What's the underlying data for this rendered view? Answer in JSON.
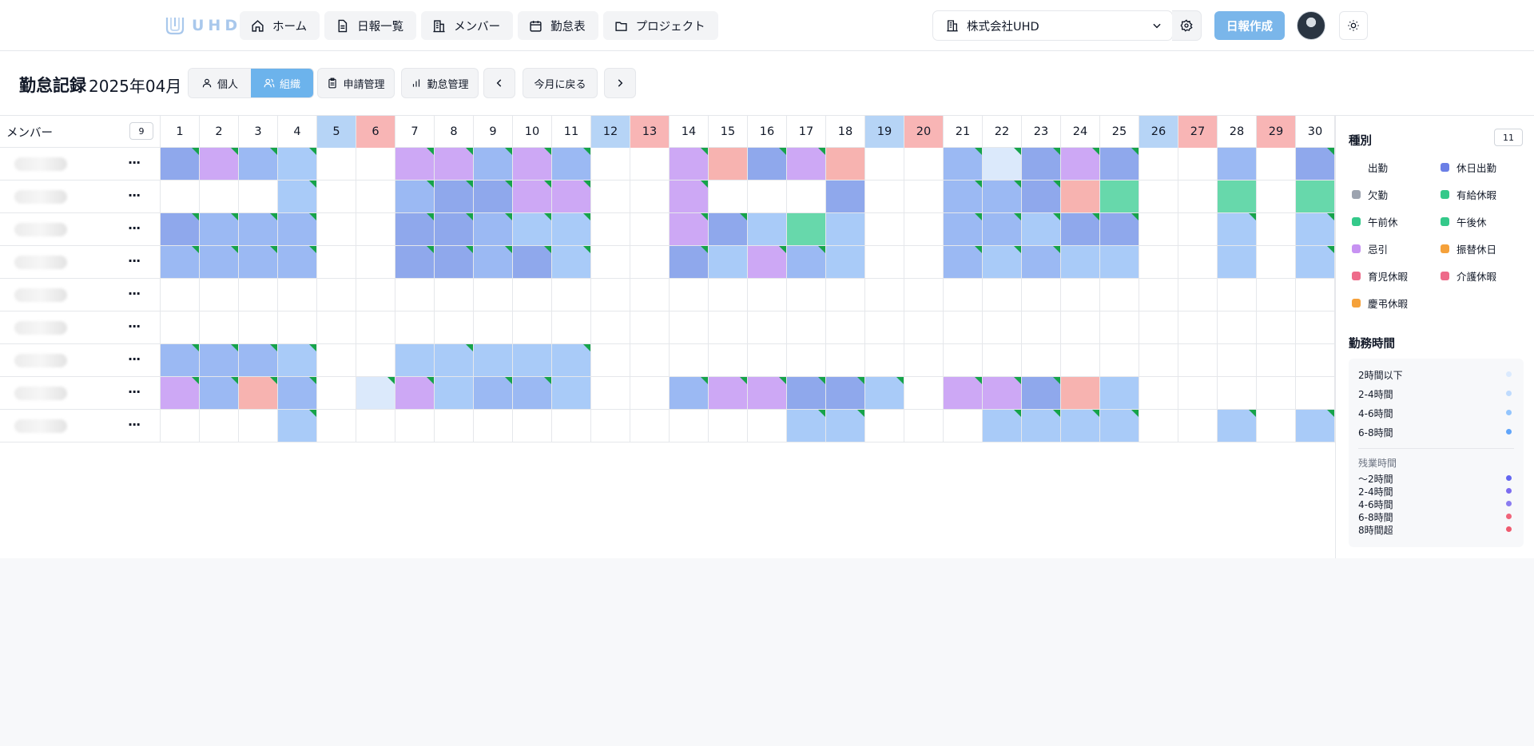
{
  "nav": {
    "logo_text": "UHD",
    "items": [
      {
        "label": "ホーム",
        "icon": "home-icon"
      },
      {
        "label": "日報一覧",
        "icon": "document-icon"
      },
      {
        "label": "メンバー",
        "icon": "building-icon"
      },
      {
        "label": "勤怠表",
        "icon": "calendar-icon"
      },
      {
        "label": "プロジェクト",
        "icon": "folder-icon"
      }
    ],
    "company": "株式会社UHD",
    "create_label": "日報作成"
  },
  "toolbar": {
    "title": "勤怠記録",
    "month": "2025年04月",
    "view_individual": "個人",
    "view_org": "組織",
    "requests": "申請管理",
    "attendance": "勤怠管理",
    "today": "今月に戻る"
  },
  "grid": {
    "member_header": "メンバー",
    "member_count": "9",
    "days": [
      "1",
      "2",
      "3",
      "4",
      "5",
      "6",
      "7",
      "8",
      "9",
      "10",
      "11",
      "12",
      "13",
      "14",
      "15",
      "16",
      "17",
      "18",
      "19",
      "20",
      "21",
      "22",
      "23",
      "24",
      "25",
      "26",
      "27",
      "28",
      "29",
      "30"
    ],
    "saturdays": [
      5,
      12,
      19,
      26
    ],
    "sundays": [
      6,
      13,
      20,
      27,
      29
    ],
    "color_key": {
      "A": "#8fa8ec",
      "B": "#a4c2f6",
      "C": "#cda8f5",
      "D": "#f7b3b0",
      "E": "#67d8ab",
      "F": "#dbe9fb",
      "G": "#a9cbf8",
      "H": "#9bb9f3"
    },
    "rows": [
      [
        "A1",
        "C1",
        "H1",
        "G1",
        "",
        "",
        "C1",
        "C1",
        "H1",
        "C1",
        "H1",
        "",
        "",
        "C1",
        "D",
        "A1",
        "C1",
        "D",
        "",
        "",
        "H1",
        "F1",
        "A1",
        "C1",
        "A1",
        "",
        "",
        "H",
        "",
        "A1"
      ],
      [
        "",
        "",
        "",
        "G1",
        "",
        "",
        "H1",
        "A1",
        "A1",
        "C1",
        "C1",
        "",
        "",
        "C1",
        "",
        "",
        "",
        "A",
        "",
        "",
        "H1",
        "H1",
        "A1",
        "D",
        "E",
        "",
        "",
        "E",
        "",
        "E"
      ],
      [
        "A1",
        "H1",
        "H1",
        "H1",
        "",
        "",
        "A1",
        "A1",
        "H1",
        "G1",
        "G1",
        "",
        "",
        "C1",
        "A1",
        "G",
        "E",
        "G",
        "",
        "",
        "H1",
        "H1",
        "G1",
        "A1",
        "A1",
        "",
        "",
        "G1",
        "",
        "G1"
      ],
      [
        "H1",
        "H1",
        "H1",
        "H1",
        "",
        "",
        "A1",
        "A1",
        "H1",
        "A1",
        "G1",
        "",
        "",
        "A1",
        "G",
        "C1",
        "H1",
        "G",
        "",
        "",
        "H1",
        "G1",
        "H1",
        "G",
        "G",
        "",
        "",
        "G",
        "",
        "G1"
      ],
      [
        "",
        "",
        "",
        "",
        "",
        "",
        "",
        "",
        "",
        "",
        "",
        "",
        "",
        "",
        "",
        "",
        "",
        "",
        "",
        "",
        "",
        "",
        "",
        "",
        "",
        "",
        "",
        "",
        "",
        ""
      ],
      [
        "",
        "",
        "",
        "",
        "",
        "",
        "",
        "",
        "",
        "",
        "",
        "",
        "",
        "",
        "",
        "",
        "",
        "",
        "",
        "",
        "",
        "",
        "",
        "",
        "",
        "",
        "",
        "",
        "",
        ""
      ],
      [
        "H1",
        "H1",
        "H1",
        "G1",
        "",
        "",
        "G",
        "G1",
        "G",
        "G",
        "G1",
        "",
        "",
        "",
        "",
        "",
        "",
        "",
        "",
        "",
        "",
        "",
        "",
        "",
        "",
        "",
        "",
        "",
        "",
        ""
      ],
      [
        "C1",
        "H1",
        "D1",
        "H1",
        "",
        "F1",
        "C1",
        "G",
        "H1",
        "H1",
        "G",
        "",
        "",
        "H1",
        "C1",
        "C1",
        "A1",
        "A1",
        "G1",
        "",
        "C1",
        "C1",
        "A1",
        "D",
        "G",
        "",
        "",
        "",
        "",
        ""
      ],
      [
        "",
        "",
        "",
        "G1",
        "",
        "",
        "",
        "",
        "",
        "",
        "",
        "",
        "",
        "",
        "",
        "",
        "G1",
        "G1",
        "",
        "",
        "",
        "G1",
        "G1",
        "G1",
        "G1",
        "",
        "",
        "G1",
        "",
        "G1"
      ]
    ]
  },
  "legend": {
    "title": "種別",
    "count": "11",
    "items": [
      {
        "label": "出勤",
        "color": "#ffffff"
      },
      {
        "label": "休日出勤",
        "color": "#6b7fe6"
      },
      {
        "label": "欠勤",
        "color": "#9ca3af"
      },
      {
        "label": "有給休暇",
        "color": "#34c98a"
      },
      {
        "label": "午前休",
        "color": "#34c98a"
      },
      {
        "label": "午後休",
        "color": "#34c98a"
      },
      {
        "label": "忌引",
        "color": "#c792f2"
      },
      {
        "label": "振替休日",
        "color": "#f5a13a"
      },
      {
        "label": "育児休暇",
        "color": "#ee6b8a"
      },
      {
        "label": "介護休暇",
        "color": "#ee6b8a"
      },
      {
        "label": "慶弔休暇",
        "color": "#f5a13a"
      }
    ],
    "work_title": "勤務時間",
    "work_levels": [
      {
        "label": "2時間以下",
        "color": "#dbeafe"
      },
      {
        "label": "2-4時間",
        "color": "#bfdbfe"
      },
      {
        "label": "4-6時間",
        "color": "#93c5fd"
      },
      {
        "label": "6-8時間",
        "color": "#60a5fa"
      }
    ],
    "overtime_title": "残業時間",
    "overtime_levels": [
      {
        "label": "〜2時間",
        "color": "#6366f1"
      },
      {
        "label": "2-4時間",
        "color": "#7c6cf0"
      },
      {
        "label": "4-6時間",
        "color": "#8b7cf0"
      },
      {
        "label": "6-8時間",
        "color": "#f0647a"
      },
      {
        "label": "8時間超",
        "color": "#ef5a6e"
      }
    ]
  }
}
